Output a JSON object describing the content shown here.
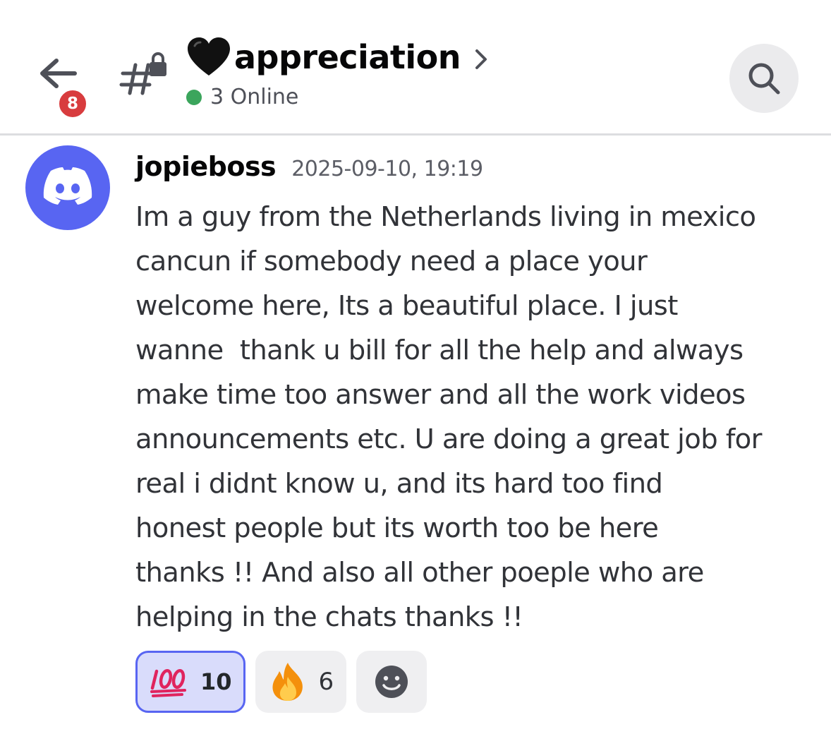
{
  "header": {
    "back_badge_count": "8",
    "channel_name": "appreciation",
    "online_text": "3 Online"
  },
  "message": {
    "username": "jopieboss",
    "timestamp": "2025-09-10, 19:19",
    "lines": [
      "Im a guy from the Netherlands living in mexico",
      "cancun if somebody need a place your",
      "welcome here, Its a beautiful place. I just",
      "wanne  thank u bill for all the help and always",
      "make time too answer and all the work videos",
      "announcements etc. U are doing a great job for",
      "real i didnt know u, and its hard too find",
      "honest people but its worth too be here",
      "thanks !! And also all other poeple who are",
      "helping in the chats thanks !!"
    ],
    "reactions": [
      {
        "emoji": "hundred-points",
        "count": "10",
        "active": true
      },
      {
        "emoji": "fire",
        "count": "6",
        "active": false
      }
    ]
  },
  "colors": {
    "accent": "#5865f2",
    "badge": "#d83c3e",
    "online": "#3ba55c"
  },
  "icons": {
    "back": "arrow-left-icon",
    "channel": "locked-text-channel-icon",
    "heart": "black-heart-icon",
    "search": "search-icon",
    "add_reaction": "smiley-add-reaction-icon"
  }
}
